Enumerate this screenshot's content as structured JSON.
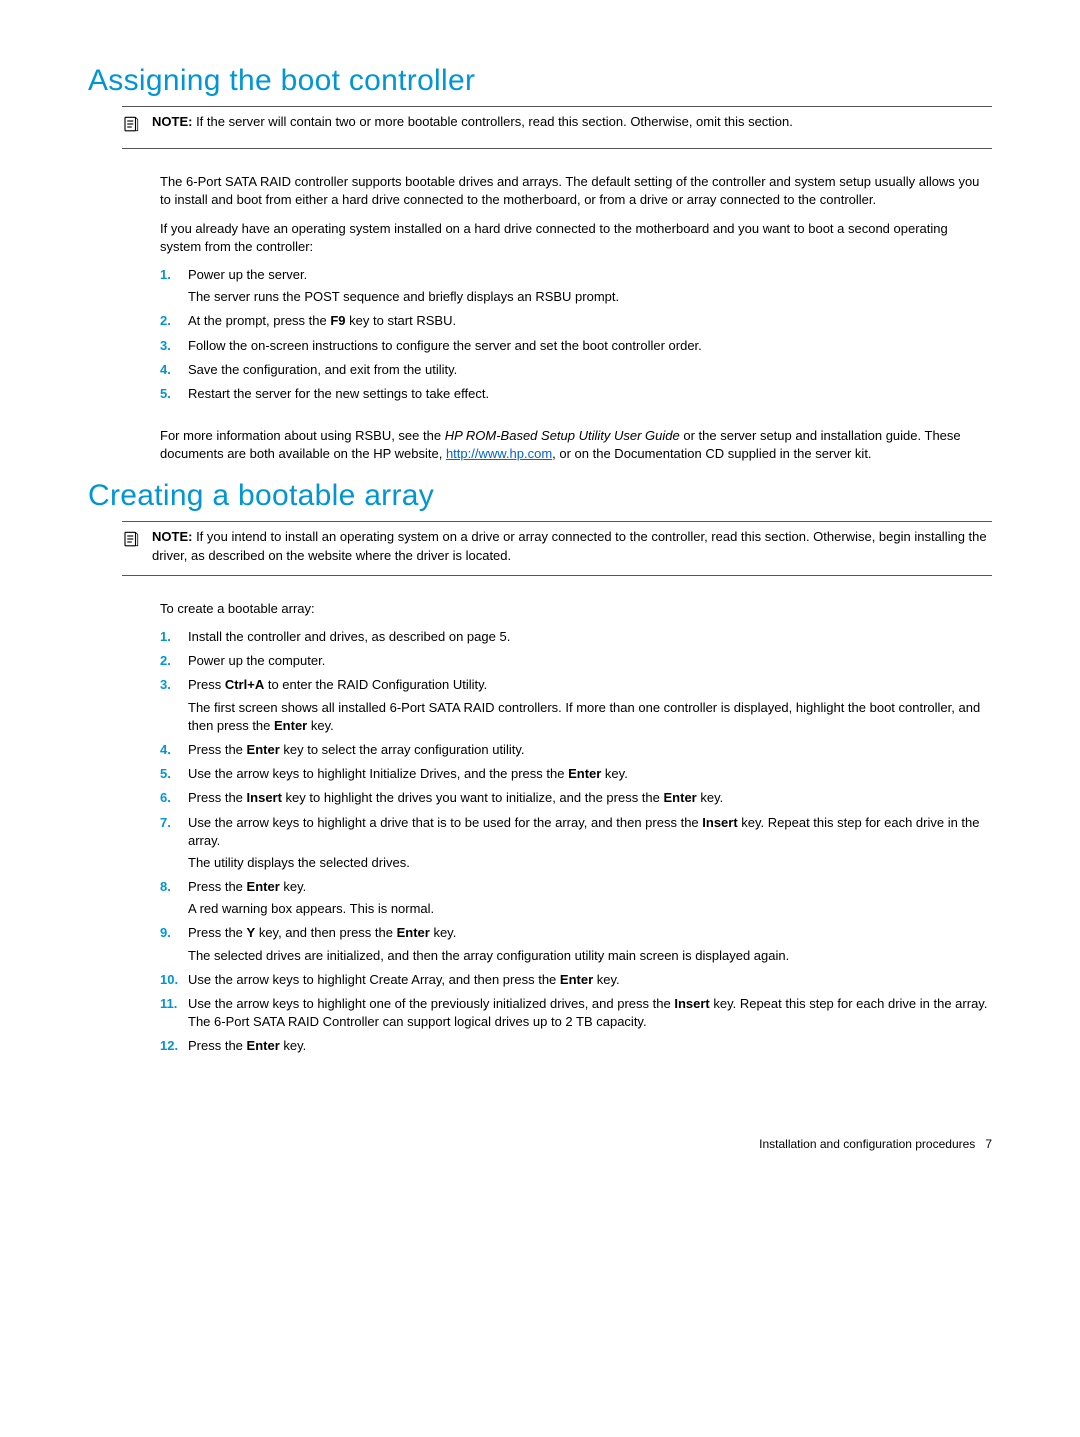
{
  "section1": {
    "title": "Assigning the boot controller",
    "note_label": "NOTE:  ",
    "note_text": "If the server will contain two or more bootable controllers, read this section. Otherwise, omit this section.",
    "para1": "The 6-Port SATA RAID controller supports bootable drives and arrays. The default setting of the controller and system setup usually allows you to install and boot from either a hard drive connected to the motherboard, or from a drive or array connected to the controller.",
    "para2": "If you already have an operating system installed on a hard drive connected to the motherboard and you want to boot a second operating system from the controller:",
    "steps": [
      {
        "n": "1.",
        "text": "Power up the server.",
        "sub": "The server runs the POST sequence and briefly displays an RSBU prompt."
      },
      {
        "n": "2.",
        "text_pre": "At the prompt, press the ",
        "text_bold": "F9",
        "text_post": " key to start RSBU."
      },
      {
        "n": "3.",
        "text": "Follow the on-screen instructions to configure the server and set the boot controller order."
      },
      {
        "n": "4.",
        "text": "Save the configuration, and exit from the utility."
      },
      {
        "n": "5.",
        "text": "Restart the server for the new settings to take effect."
      }
    ],
    "para3_pre": "For more information about using RSBU, see the ",
    "para3_italic": "HP ROM-Based Setup Utility User Guide",
    "para3_mid": " or the server setup and installation guide. These documents are both available on the HP website, ",
    "para3_link": "http://www.hp.com",
    "para3_post": ", or on the Documentation CD supplied in the server kit."
  },
  "section2": {
    "title": "Creating a bootable array",
    "note_label": "NOTE:  ",
    "note_text": "If you intend to install an operating system on a drive or array connected to the controller, read this section. Otherwise, begin installing the driver, as described on the website where the driver is located.",
    "para1": "To create a bootable array:",
    "steps": [
      {
        "n": "1.",
        "text": "Install the controller and drives, as described on page 5."
      },
      {
        "n": "2.",
        "text": "Power up the computer."
      },
      {
        "n": "3.",
        "text_pre": "Press ",
        "text_bold": "Ctrl+A",
        "text_post": " to enter the RAID Configuration Utility.",
        "sub_pre": "The first screen shows all installed 6-Port SATA RAID controllers. If more than one controller is displayed, highlight the boot controller, and then press the ",
        "sub_bold": "Enter",
        "sub_post": " key."
      },
      {
        "n": "4.",
        "text_pre": "Press the ",
        "text_bold": "Enter",
        "text_post": " key to select the array configuration utility."
      },
      {
        "n": "5.",
        "text_pre": "Use the arrow keys to highlight Initialize Drives, and the press the ",
        "text_bold": "Enter",
        "text_post": " key."
      },
      {
        "n": "6.",
        "text_pre": "Press the ",
        "text_bold": "Insert",
        "text_mid": " key to highlight the drives you want to initialize, and the press the ",
        "text_bold2": "Enter",
        "text_post": " key."
      },
      {
        "n": "7.",
        "text_pre": "Use the arrow keys to highlight a drive that is to be used for the array, and then press the ",
        "text_bold": "Insert",
        "text_post": " key. Repeat this step for each drive in the array.",
        "sub": "The utility displays the selected drives."
      },
      {
        "n": "8.",
        "text_pre": "Press the ",
        "text_bold": "Enter",
        "text_post": " key.",
        "sub": "A red warning box appears. This is normal."
      },
      {
        "n": "9.",
        "text_pre": "Press the ",
        "text_bold": "Y",
        "text_mid": " key, and then press the ",
        "text_bold2": "Enter",
        "text_post": " key.",
        "sub": "The selected drives are initialized, and then the array configuration utility main screen is displayed again."
      },
      {
        "n": "10.",
        "text_pre": "Use the arrow keys to highlight Create Array, and then press the ",
        "text_bold": "Enter",
        "text_post": " key."
      },
      {
        "n": "11.",
        "text_pre": "Use the arrow keys to highlight one of the previously initialized drives, and press the ",
        "text_bold": "Insert",
        "text_post": " key. Repeat this step for each drive in the array. The 6-Port SATA RAID Controller can support logical drives up to 2 TB capacity."
      },
      {
        "n": "12.",
        "text_pre": "Press the ",
        "text_bold": "Enter",
        "text_post": " key."
      }
    ]
  },
  "footer": {
    "text": "Installation and configuration procedures",
    "page": "7"
  }
}
